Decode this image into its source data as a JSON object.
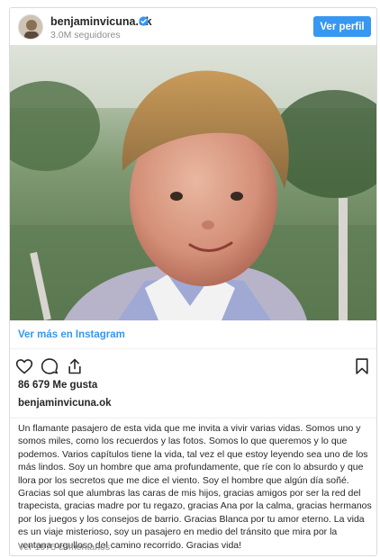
{
  "header": {
    "username": "benjaminvicuna.ok",
    "followers": "3.0M seguidores",
    "follow_label": "Ver perfil"
  },
  "post": {
    "view_more": "Ver más en Instagram",
    "likes": "86 679 Me gusta",
    "caption_user": "benjaminvicuna.ok",
    "caption": "Un flamante pasajero de esta vida que me invita a vivir varias vidas. Somos uno y somos miles, como los recuerdos y las fotos. Somos lo que queremos y lo que podemos. Varios capítulos tiene la vida, tal vez el que estoy leyendo sea uno de los más lindos. Soy un hombre que ama profundamente, que ríe con lo absurdo y que llora por los secretos que me dice el viento. Soy el hombre que algún día soñé. Gracias sol que alumbras las caras de mis hijos, gracias amigos por ser la red del trapecista, gracias madre por tu regazo, gracias Ana por la calma, gracias hermanos por los juegos y los consejos de barrio. Gracias Blanca por tu amor eterno. La vida es un viaje misterioso, soy un pasajero en medio del tránsito que mira por la ventana orgulloso del camino recorrido. Gracias vida!",
    "comments_link": "Ver 1975 comentarios"
  },
  "icons": [
    "verified-badge-icon",
    "heart-icon",
    "comment-icon",
    "share-icon",
    "bookmark-icon"
  ],
  "colors": {
    "accent": "#3897f0",
    "text": "#262626",
    "muted": "#8e8e8e",
    "border": "#dbdbdb"
  }
}
